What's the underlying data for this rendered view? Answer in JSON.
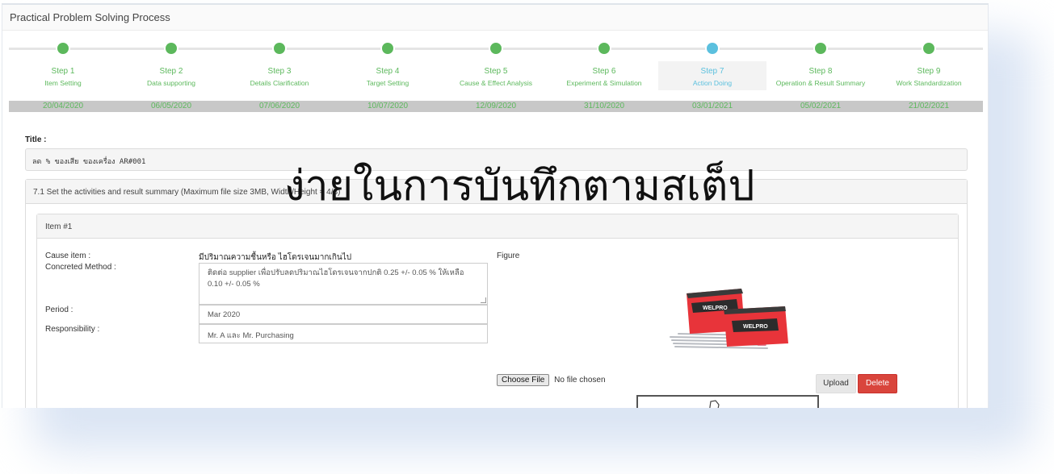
{
  "app": {
    "title": "Practical Problem Solving Process"
  },
  "steps": [
    {
      "label": "Step 1",
      "sub": "Item Setting",
      "date": "20/04/2020"
    },
    {
      "label": "Step 2",
      "sub": "Data supporting",
      "date": "06/05/2020"
    },
    {
      "label": "Step 3",
      "sub": "Details Clarification",
      "date": "07/06/2020"
    },
    {
      "label": "Step 4",
      "sub": "Target Setting",
      "date": "10/07/2020"
    },
    {
      "label": "Step 5",
      "sub": "Cause & Effect Analysis",
      "date": "12/09/2020"
    },
    {
      "label": "Step 6",
      "sub": "Experiment & Simulation",
      "date": "31/10/2020"
    },
    {
      "label": "Step 7",
      "sub": "Action Doing",
      "date": "03/01/2021"
    },
    {
      "label": "Step 8",
      "sub": "Operation & Result Summary",
      "date": "05/02/2021"
    },
    {
      "label": "Step 9",
      "sub": "Work Standardization",
      "date": "21/02/2021"
    }
  ],
  "colors": {
    "done": "#5cb85c",
    "active": "#5bc0de",
    "danger": "#d9453c"
  },
  "title_section": {
    "label": "Title :",
    "value": "ลด % ของเสีย ของเครื่อง AR#001"
  },
  "panel": {
    "heading": "7.1 Set the activities and result summary (Maximum file size 3MB, Width/Height = 4/3)"
  },
  "item": {
    "heading": "Item #1",
    "cause_label": "Cause item :",
    "cause_value": "มีปริมาณความชื้นหรือ ไฮโดรเจนมากเกินไป",
    "method_label": "Concreted Method :",
    "method_value": "ติดต่อ supplier เพื่อปรับลดปริมาณไฮโดรเจนจากปกติ 0.25 +/- 0.05 % ให้เหลือ 0.10 +/- 0.05 %",
    "period_label": "Period :",
    "period_value": "Mar 2020",
    "responsibility_label": "Responsibility :",
    "responsibility_value": "Mr. A และ Mr. Purchasing",
    "figure_label": "Figure",
    "figure_brand": "WELPRO",
    "choose_file_label": "Choose File",
    "no_file_text": "No file chosen",
    "upload_label": "Upload",
    "delete_label": "Delete"
  },
  "overlay": {
    "caption": "ง่ายในการบันทึกตามสเต็ป"
  }
}
